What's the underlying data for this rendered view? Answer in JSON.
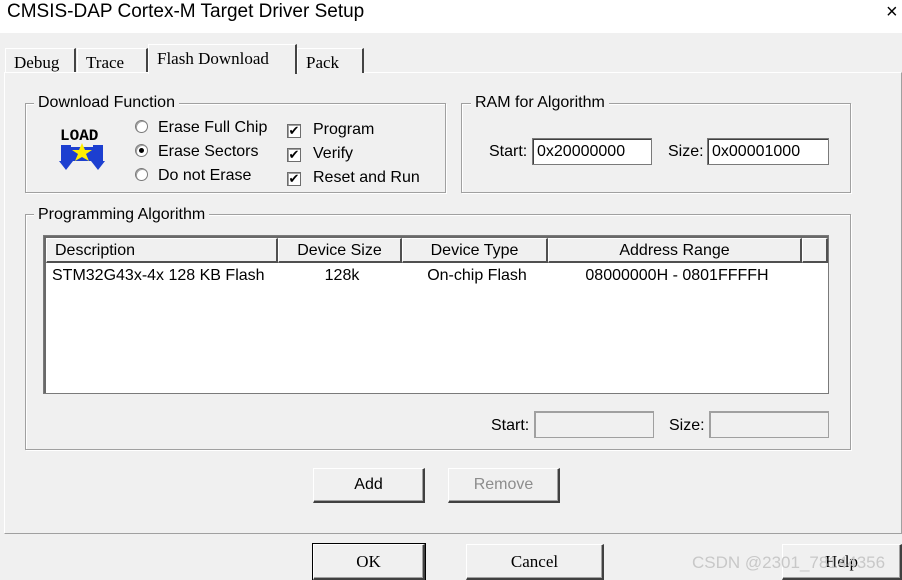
{
  "window": {
    "title": "CMSIS-DAP Cortex-M Target Driver Setup",
    "close_glyph": "×"
  },
  "tabs": [
    {
      "label": "Debug",
      "active": false
    },
    {
      "label": "Trace",
      "active": false
    },
    {
      "label": "Flash Download",
      "active": true
    },
    {
      "label": "Pack",
      "active": false
    }
  ],
  "download_function": {
    "legend": "Download Function",
    "icon_text": "LOAD",
    "radios": [
      {
        "label": "Erase Full Chip",
        "selected": false
      },
      {
        "label": "Erase Sectors",
        "selected": true
      },
      {
        "label": "Do not Erase",
        "selected": false
      }
    ],
    "checkboxes": [
      {
        "label": "Program",
        "checked": true
      },
      {
        "label": "Verify",
        "checked": true
      },
      {
        "label": "Reset and Run",
        "checked": true
      }
    ],
    "check_glyph": "✔"
  },
  "ram_for_algorithm": {
    "legend": "RAM for Algorithm",
    "start_label": "Start:",
    "start_value": "0x20000000",
    "size_label": "Size:",
    "size_value": "0x00001000"
  },
  "programming_algorithm": {
    "legend": "Programming Algorithm",
    "columns": [
      "Description",
      "Device Size",
      "Device Type",
      "Address Range"
    ],
    "rows": [
      {
        "description": "STM32G43x-4x 128 KB Flash",
        "device_size": "128k",
        "device_type": "On-chip Flash",
        "address_range": "08000000H - 0801FFFFH"
      }
    ],
    "start_label": "Start:",
    "start_value": "",
    "size_label": "Size:",
    "size_value": ""
  },
  "buttons": {
    "add": "Add",
    "remove": "Remove",
    "ok": "OK",
    "cancel": "Cancel",
    "help": "Help"
  },
  "watermark": "CSDN @2301_78144356",
  "colors": {
    "dialog_bg": "#f0f0f0",
    "icon_blue": "#1c3fd0",
    "icon_yellow": "#ffee00",
    "disabled_text": "#8d8d8d"
  }
}
